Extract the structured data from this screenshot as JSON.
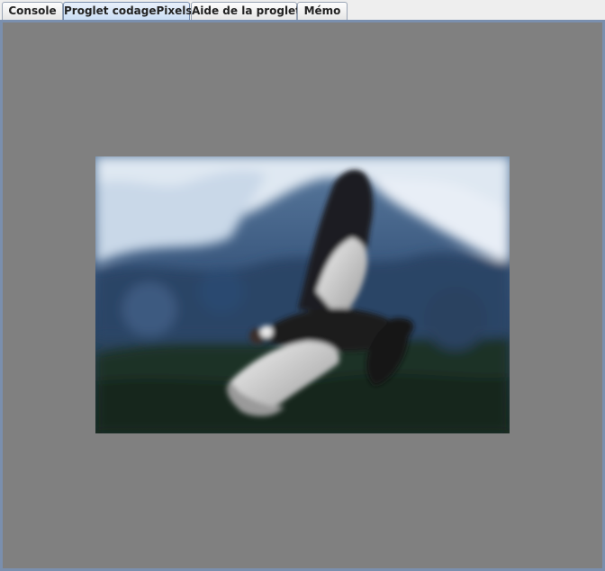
{
  "tabs": [
    {
      "label": "Console",
      "selected": false
    },
    {
      "label": "Proglet codagePixels",
      "selected": true
    },
    {
      "label": "Aide de la proglet",
      "selected": false
    },
    {
      "label": "Mémo",
      "selected": false
    }
  ],
  "canvas": {
    "background": "#808080",
    "image": {
      "subject": "condor-in-flight-over-snowy-mountains",
      "blurred": true
    }
  },
  "colors": {
    "selected_tab": "#c9ddf4",
    "border": "#7a8fae"
  }
}
